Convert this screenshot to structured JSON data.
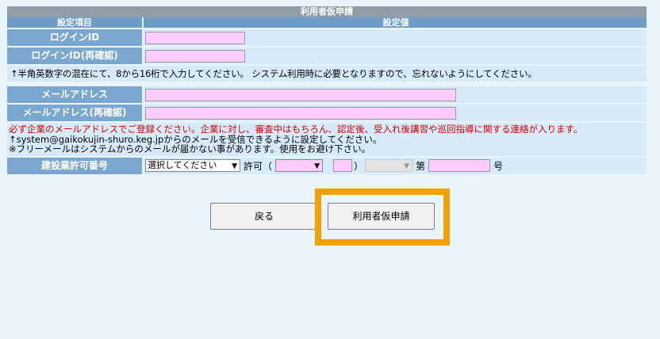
{
  "form": {
    "title": "利用者仮申請",
    "col_item": "設定項目",
    "col_value": "設定値",
    "login_id_label": "ログインID",
    "login_id_confirm_label": "ログインID(再確認)",
    "login_note": "↑半角英数字の混在にて、8から16桁で入力してください。 システム利用時に必要となりますので、忘れないようにしてください。",
    "email_label": "メールアドレス",
    "email_confirm_label": "メールアドレス(再確認)",
    "email_note_red": "必ず企業のメールアドレスでご登録ください。企業に対し、審査中はもちろん、認定後、受入れ後講習や巡回指導に関する連絡が入ります。",
    "email_note_2": "↑system@gaikokujin-shuro.keg.jpからのメールを受信できるように設定してください。",
    "email_note_3": "※フリーメールはシステムからのメールが届かない事があります。使用をお避け下さい。",
    "license_label": "建設業許可番号",
    "license_select": "選択してください",
    "license_kyoka": "許可（",
    "license_paren_close": "）",
    "license_dai": "第",
    "license_go": "号"
  },
  "buttons": {
    "back": "戻る",
    "submit": "利用者仮申請"
  },
  "colors": {
    "required_field": "#ffccff",
    "label_bg": "#7aa7cf",
    "highlight": "#f2a100"
  }
}
